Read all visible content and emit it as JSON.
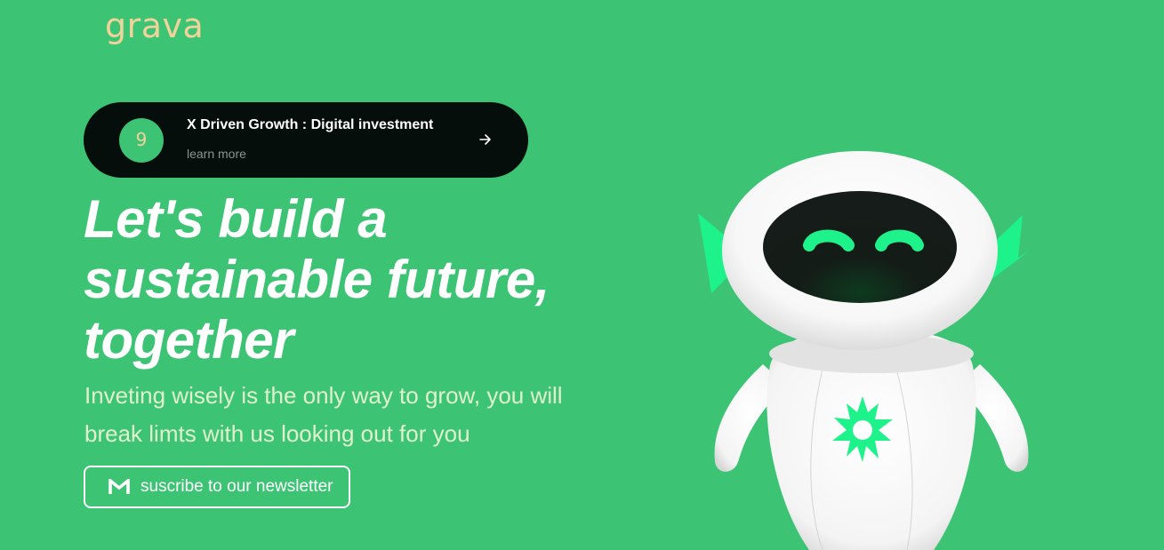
{
  "brand": {
    "name": "grava"
  },
  "promo": {
    "badge": "9",
    "title": "X Driven Growth : Digital investment",
    "subtitle": "learn more",
    "arrow_icon": "arrow-right-icon"
  },
  "hero": {
    "headline_lines": [
      "Let's build a",
      "sustainable future,",
      "together"
    ],
    "subtext": "Inveting wisely is the only way to grow, you will break limts with us looking out for you"
  },
  "newsletter": {
    "icon": "gmail-icon",
    "label": "suscribe to our newsletter"
  },
  "illustration": {
    "name": "robot-mascot"
  },
  "colors": {
    "background": "#3cc474",
    "logo": "#f1d29b",
    "promo_bg": "#050e0a",
    "accent_neon": "#1ef28a",
    "text": "#ffffff"
  }
}
